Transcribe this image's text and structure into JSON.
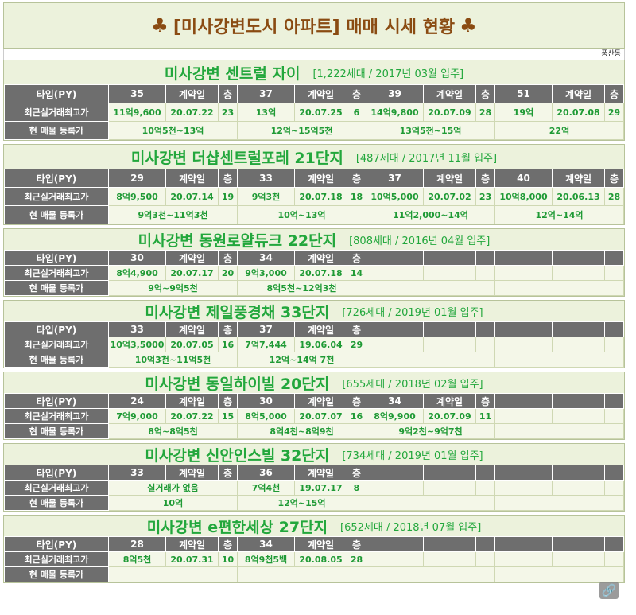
{
  "header": {
    "title": "[미사강변도시 아파트] 매매 시세 현황",
    "club_symbol": "♣",
    "location": "풍산동"
  },
  "labels": {
    "type": "타입(PY)",
    "contract": "계약일",
    "floor": "층",
    "recent_high": "최근실거래최고가",
    "listing": "현 매물 등록가"
  },
  "complexes": [
    {
      "name": "미사강변 센트럴 자이",
      "info": "[1,222세대 / 2017년 03월 입주]",
      "types": [
        {
          "py": "35",
          "price": "11억9,600",
          "date": "20.07.22",
          "floor": "23",
          "listing": "10억5천~13억"
        },
        {
          "py": "37",
          "price": "13억",
          "date": "20.07.25",
          "floor": "6",
          "listing": "12억~15억5천"
        },
        {
          "py": "39",
          "price": "14억9,800",
          "date": "20.07.09",
          "floor": "28",
          "listing": "13억5천~15억"
        },
        {
          "py": "51",
          "price": "19억",
          "date": "20.07.08",
          "floor": "29",
          "listing": "22억"
        }
      ]
    },
    {
      "name": "미사강변 더샵센트럴포레 21단지",
      "info": "[487세대 / 2017년 11월 입주]",
      "types": [
        {
          "py": "29",
          "price": "8억9,500",
          "date": "20.07.14",
          "floor": "19",
          "listing": "9억3천~11억3천"
        },
        {
          "py": "33",
          "price": "9억3천",
          "date": "20.07.18",
          "floor": "18",
          "listing": "10억~13억"
        },
        {
          "py": "37",
          "price": "10억5,000",
          "date": "20.07.02",
          "floor": "23",
          "listing": "11억2,000~14억"
        },
        {
          "py": "40",
          "price": "10억8,000",
          "date": "20.06.13",
          "floor": "28",
          "listing": "12억~14억"
        }
      ]
    },
    {
      "name": "미사강변 동원로얄듀크 22단지",
      "info": "[808세대 / 2016년 04월 입주]",
      "types": [
        {
          "py": "30",
          "price": "8억4,900",
          "date": "20.07.17",
          "floor": "20",
          "listing": "9억~9억5천"
        },
        {
          "py": "34",
          "price": "9억3,000",
          "date": "20.07.18",
          "floor": "14",
          "listing": "8억5천~12억3천"
        }
      ]
    },
    {
      "name": "미사강변 제일풍경채 33단지",
      "info": "[726세대 / 2019년 01월 입주]",
      "types": [
        {
          "py": "33",
          "price": "10억3,5000",
          "date": "20.07.05",
          "floor": "16",
          "listing": "10억3천~11억5천"
        },
        {
          "py": "37",
          "price": "7억7,444",
          "date": "19.06.04",
          "floor": "29",
          "listing": "12억~14억 7천"
        }
      ]
    },
    {
      "name": "미사강변 동일하이빌 20단지",
      "info": "[655세대 / 2018년 02월 입주]",
      "types": [
        {
          "py": "24",
          "price": "7억9,000",
          "date": "20.07.22",
          "floor": "15",
          "listing": "8억~8억5천"
        },
        {
          "py": "30",
          "price": "8억5,000",
          "date": "20.07.07",
          "floor": "16",
          "listing": "8억4천~8억9천"
        },
        {
          "py": "34",
          "price": "8억9,900",
          "date": "20.07.09",
          "floor": "11",
          "listing": "9억2천~9억7천"
        }
      ]
    },
    {
      "name": "미사강변 신안인스빌 32단지",
      "info": "[734세대 / 2019년 01월 입주]",
      "types": [
        {
          "py": "33",
          "price_merged": "실거래가 없음",
          "listing": "10억"
        },
        {
          "py": "36",
          "price": "7억4천",
          "date": "19.07.17",
          "floor": "8",
          "listing": "12억~15억"
        }
      ]
    },
    {
      "name": "미사강변 e편한세상 27단지",
      "info": "[652세대 / 2018년 07월 입주]",
      "types": [
        {
          "py": "28",
          "price": "8억5천",
          "date": "20.07.31",
          "floor": "10",
          "listing": ""
        },
        {
          "py": "34",
          "price": "8억9천5백",
          "date": "20.08.05",
          "floor": "28",
          "listing": ""
        }
      ]
    }
  ],
  "link_icon": "link-icon"
}
